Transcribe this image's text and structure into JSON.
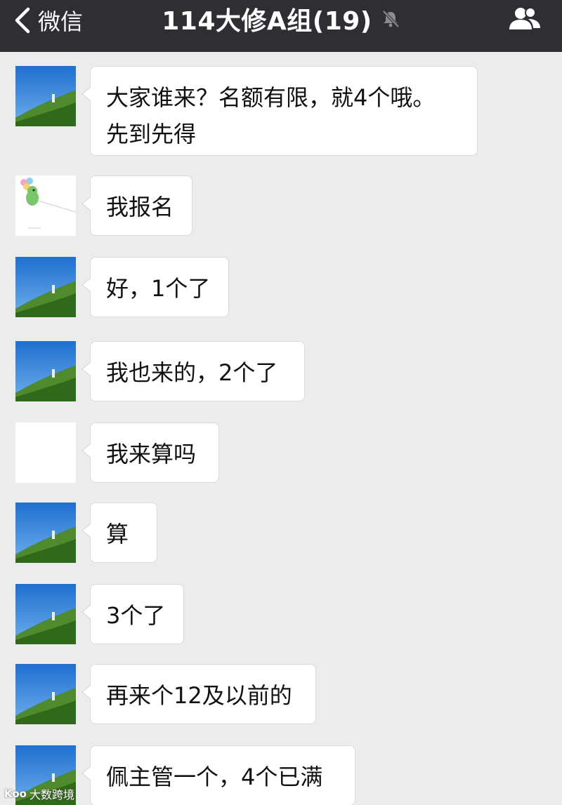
{
  "nav": {
    "back_label": "微信",
    "title": "114大修A组(19)"
  },
  "messages": [
    {
      "avatar": "landscape",
      "text": "大家谁来？名额有限，就4个哦。\n先到先得"
    },
    {
      "avatar": "balloon",
      "text": "我报名"
    },
    {
      "avatar": "landscape",
      "text": "好，1个了"
    },
    {
      "avatar": "landscape",
      "text": "我也来的，2个了"
    },
    {
      "avatar": "blank",
      "text": "我来算吗"
    },
    {
      "avatar": "landscape",
      "text": "算"
    },
    {
      "avatar": "landscape",
      "text": "3个了"
    },
    {
      "avatar": "landscape",
      "text": "再来个12及以前的"
    },
    {
      "avatar": "landscape",
      "text": "佩主管一个，4个已满"
    }
  ],
  "watermark": {
    "logo": "Koo",
    "text": "大数跨境"
  },
  "colors": {
    "nav_bg": "#2e2e33",
    "chat_bg": "#ececec",
    "bubble_bg": "#ffffff"
  }
}
